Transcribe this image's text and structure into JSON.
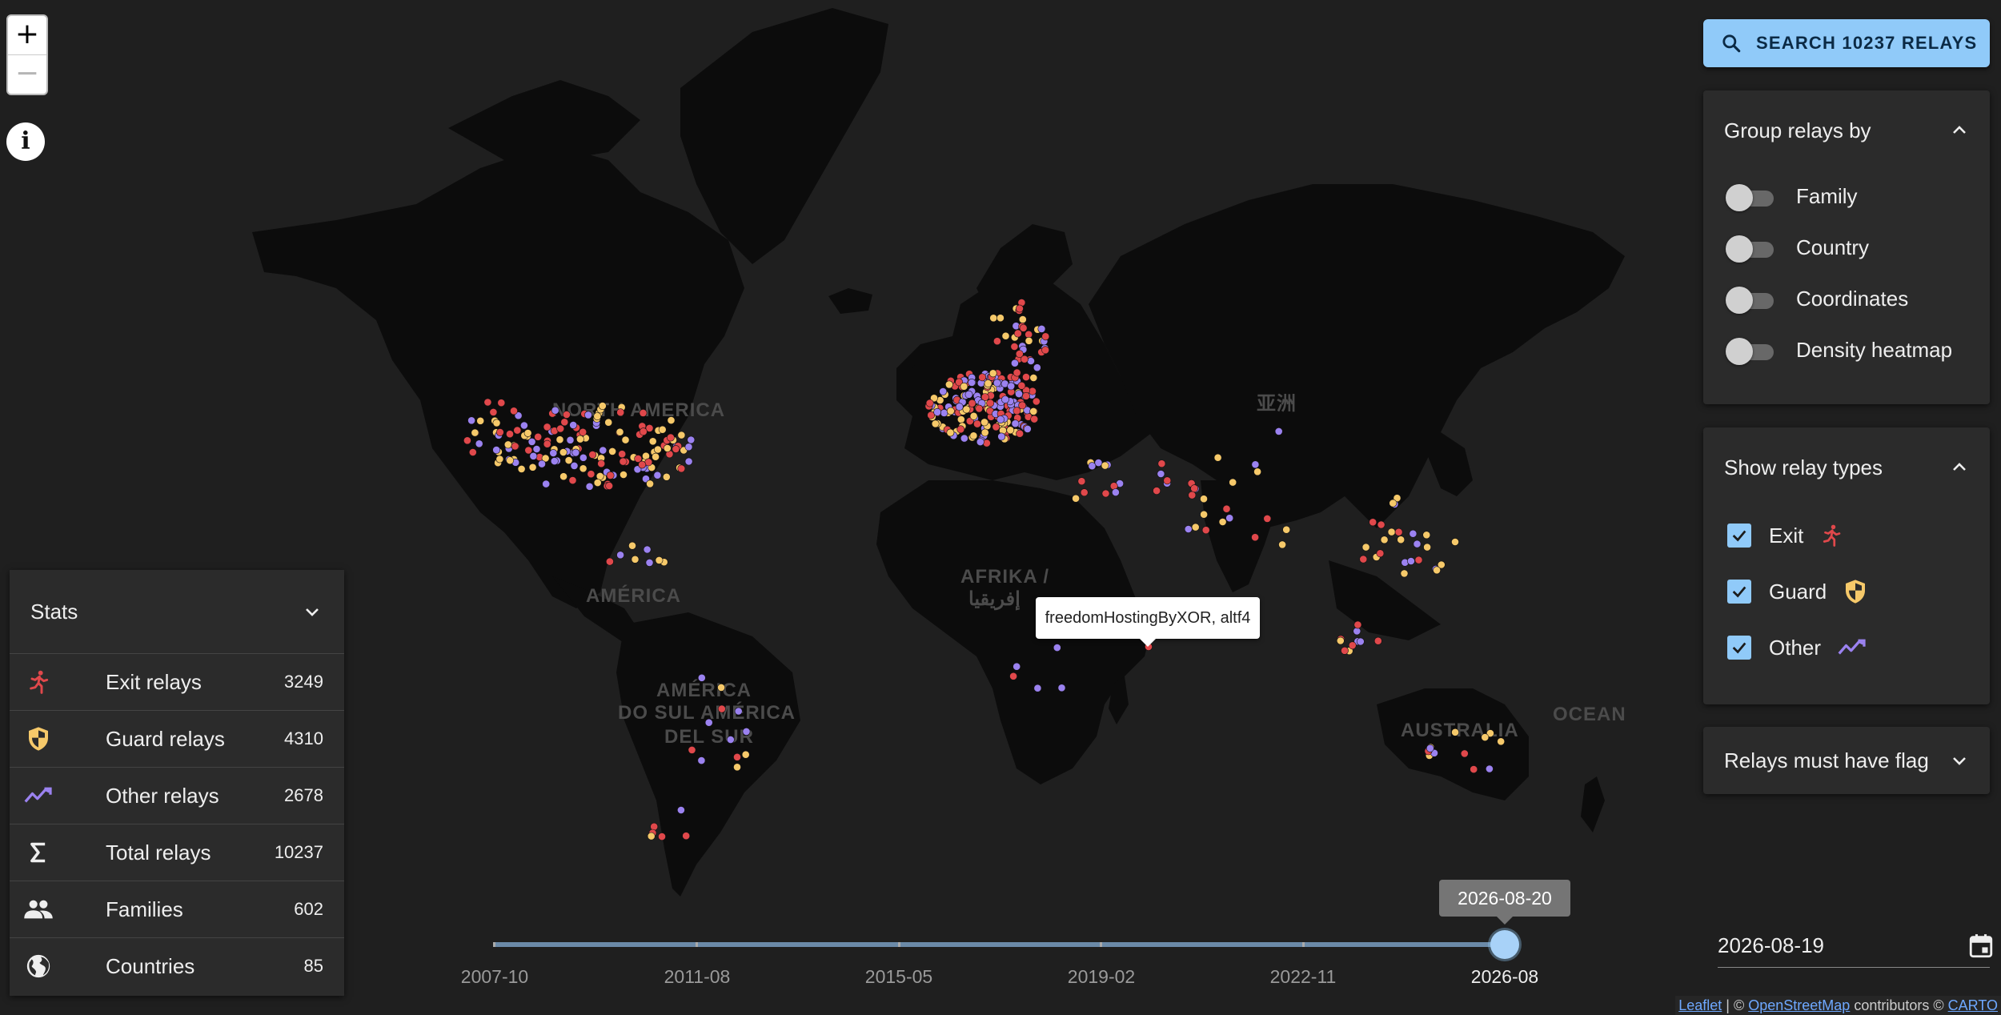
{
  "colors": {
    "exit": "#e0484b",
    "guard": "#f6c96a",
    "other": "#9b82f0",
    "accent": "#90caf9"
  },
  "map": {
    "labels": [
      {
        "id": "north-america",
        "text": "NORTH AMERICA"
      },
      {
        "id": "america",
        "text": "AMÉRICA"
      },
      {
        "id": "south-america-1",
        "text": "AMÉRICA"
      },
      {
        "id": "south-america-2",
        "text": "DO SUL AMÉRICA"
      },
      {
        "id": "south-america-3",
        "text": "DEL SUR"
      },
      {
        "id": "africa-1",
        "text": "AFRIKA /"
      },
      {
        "id": "africa-2",
        "text": "إفريقيا"
      },
      {
        "id": "asia",
        "text": "亚洲"
      },
      {
        "id": "australia",
        "text": "AUSTRALIA"
      },
      {
        "id": "ocean",
        "text": "OCEAN"
      }
    ],
    "tooltip": "freedomHostingByXOR, altf4"
  },
  "zoom": {
    "in": "+",
    "out": "−",
    "info": "i"
  },
  "search": {
    "label": "SEARCH 10237 RELAYS",
    "icon": "search-icon"
  },
  "group_panel": {
    "title": "Group relays by",
    "options": [
      {
        "label": "Family",
        "on": false
      },
      {
        "label": "Country",
        "on": false
      },
      {
        "label": "Coordinates",
        "on": false
      },
      {
        "label": "Density heatmap",
        "on": false
      }
    ]
  },
  "types_panel": {
    "title": "Show relay types",
    "types": [
      {
        "label": "Exit",
        "checked": true,
        "icon": "running-person-icon"
      },
      {
        "label": "Guard",
        "checked": true,
        "icon": "shield-icon"
      },
      {
        "label": "Other",
        "checked": true,
        "icon": "trending-line-icon"
      }
    ]
  },
  "flag_panel": {
    "title": "Relays must have flag"
  },
  "stats": {
    "title": "Stats",
    "rows": [
      {
        "label": "Exit relays",
        "value": "3249",
        "icon": "running-person-icon"
      },
      {
        "label": "Guard relays",
        "value": "4310",
        "icon": "shield-icon"
      },
      {
        "label": "Other relays",
        "value": "2678",
        "icon": "trending-line-icon"
      },
      {
        "label": "Total relays",
        "value": "10237",
        "icon": "sigma-icon"
      },
      {
        "label": "Families",
        "value": "602",
        "icon": "people-icon"
      },
      {
        "label": "Countries",
        "value": "85",
        "icon": "globe-icon"
      }
    ]
  },
  "timeline": {
    "current": "2026-08-20",
    "position": 1.0,
    "ticks": [
      "2007-10",
      "2011-08",
      "2015-05",
      "2019-02",
      "2022-11",
      "2026-08"
    ]
  },
  "date_input": {
    "value": "2026-08-19",
    "icon": "calendar-icon"
  },
  "attribution": {
    "leaflet": "Leaflet",
    "sep": " | © ",
    "osm": "OpenStreetMap",
    "contrib": " contributors © ",
    "carto": "CARTO"
  }
}
